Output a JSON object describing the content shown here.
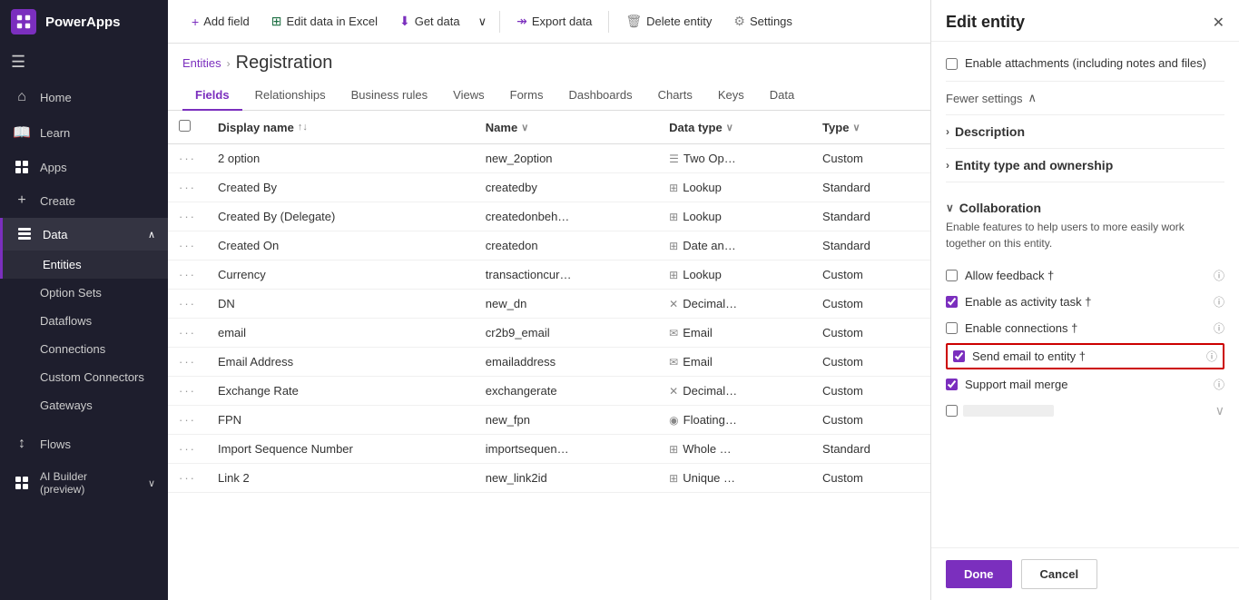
{
  "app": {
    "title": "PowerApps"
  },
  "nav": {
    "hamburger_icon": "☰",
    "logo_icon": "⊞",
    "items": [
      {
        "id": "home",
        "label": "Home",
        "icon": "⌂",
        "active": false
      },
      {
        "id": "learn",
        "label": "Learn",
        "icon": "📖",
        "active": false
      },
      {
        "id": "apps",
        "label": "Apps",
        "icon": "⊞",
        "active": false
      },
      {
        "id": "create",
        "label": "Create",
        "icon": "+",
        "active": false
      },
      {
        "id": "data",
        "label": "Data",
        "icon": "⊞",
        "active": true,
        "chevron": "∧"
      }
    ],
    "sub_items": [
      {
        "id": "entities",
        "label": "Entities",
        "active": true
      },
      {
        "id": "option-sets",
        "label": "Option Sets",
        "active": false
      },
      {
        "id": "dataflows",
        "label": "Dataflows",
        "active": false
      },
      {
        "id": "connections",
        "label": "Connections",
        "active": false
      },
      {
        "id": "custom-connectors",
        "label": "Custom Connectors",
        "active": false
      },
      {
        "id": "gateways",
        "label": "Gateways",
        "active": false
      }
    ],
    "bottom_items": [
      {
        "id": "flows",
        "label": "Flows",
        "icon": "↕"
      },
      {
        "id": "ai-builder",
        "label": "AI Builder\n(preview)",
        "icon": "⊞",
        "chevron": "∨"
      }
    ]
  },
  "toolbar": {
    "add_field_label": "Add field",
    "edit_excel_label": "Edit data in Excel",
    "get_data_label": "Get data",
    "export_data_label": "Export data",
    "delete_entity_label": "Delete entity",
    "settings_label": "Settings"
  },
  "breadcrumb": {
    "parent": "Entities",
    "separator": "›",
    "current": "Registration"
  },
  "tabs": [
    {
      "id": "fields",
      "label": "Fields",
      "active": true
    },
    {
      "id": "relationships",
      "label": "Relationships",
      "active": false
    },
    {
      "id": "business-rules",
      "label": "Business rules",
      "active": false
    },
    {
      "id": "views",
      "label": "Views",
      "active": false
    },
    {
      "id": "forms",
      "label": "Forms",
      "active": false
    },
    {
      "id": "dashboards",
      "label": "Dashboards",
      "active": false
    },
    {
      "id": "charts",
      "label": "Charts",
      "active": false
    },
    {
      "id": "keys",
      "label": "Keys",
      "active": false
    },
    {
      "id": "data",
      "label": "Data",
      "active": false
    }
  ],
  "table": {
    "columns": [
      {
        "id": "display-name",
        "label": "Display name",
        "sort": "↑↓"
      },
      {
        "id": "name",
        "label": "Name",
        "sort": "∨"
      },
      {
        "id": "data-type",
        "label": "Data type",
        "sort": "∨"
      },
      {
        "id": "type",
        "label": "Type",
        "sort": "∨"
      }
    ],
    "rows": [
      {
        "display_name": "2 option",
        "name": "new_2option",
        "data_type": "Two Op…",
        "data_type_icon": "☰",
        "type": "Custom"
      },
      {
        "display_name": "Created By",
        "name": "createdby",
        "data_type": "Lookup",
        "data_type_icon": "⊞",
        "type": "Standard"
      },
      {
        "display_name": "Created By (Delegate)",
        "name": "createdonbeh…",
        "data_type": "Lookup",
        "data_type_icon": "⊞",
        "type": "Standard"
      },
      {
        "display_name": "Created On",
        "name": "createdon",
        "data_type": "Date an…",
        "data_type_icon": "⊞",
        "type": "Standard"
      },
      {
        "display_name": "Currency",
        "name": "transactioncur…",
        "data_type": "Lookup",
        "data_type_icon": "⊞",
        "type": "Custom"
      },
      {
        "display_name": "DN",
        "name": "new_dn",
        "data_type": "Decimal…",
        "data_type_icon": "✕",
        "type": "Custom"
      },
      {
        "display_name": "email",
        "name": "cr2b9_email",
        "data_type": "Email",
        "data_type_icon": "✉",
        "type": "Custom"
      },
      {
        "display_name": "Email Address",
        "name": "emailaddress",
        "data_type": "Email",
        "data_type_icon": "✉",
        "type": "Custom"
      },
      {
        "display_name": "Exchange Rate",
        "name": "exchangerate",
        "data_type": "Decimal…",
        "data_type_icon": "✕",
        "type": "Custom"
      },
      {
        "display_name": "FPN",
        "name": "new_fpn",
        "data_type": "Floating…",
        "data_type_icon": "◉",
        "type": "Custom"
      },
      {
        "display_name": "Import Sequence Number",
        "name": "importsequen…",
        "data_type": "Whole …",
        "data_type_icon": "⊞",
        "type": "Standard"
      },
      {
        "display_name": "Link 2",
        "name": "new_link2id",
        "data_type": "Unique …",
        "data_type_icon": "⊞",
        "type": "Custom"
      }
    ]
  },
  "panel": {
    "title": "Edit entity",
    "close_icon": "✕",
    "enable_attachments_label": "Enable attachments (including notes and files)",
    "enable_attachments_checked": false,
    "fewer_settings_label": "Fewer settings",
    "sections": [
      {
        "id": "description",
        "label": "Description",
        "collapsed": true,
        "chevron": "›"
      },
      {
        "id": "entity-type",
        "label": "Entity type and ownership",
        "collapsed": true,
        "chevron": "›"
      }
    ],
    "collaboration": {
      "title": "Collaboration",
      "expanded": true,
      "chevron": "∨",
      "description": "Enable features to help users to more easily work together on this entity.",
      "items": [
        {
          "id": "allow-feedback",
          "label": "Allow feedback †",
          "checked": false,
          "highlighted": false
        },
        {
          "id": "enable-activity-task",
          "label": "Enable as activity task †",
          "checked": true,
          "highlighted": false
        },
        {
          "id": "enable-connections",
          "label": "Enable connections †",
          "checked": false,
          "highlighted": false
        },
        {
          "id": "send-email",
          "label": "Send email to entity †",
          "checked": true,
          "highlighted": true
        },
        {
          "id": "support-mail-merge",
          "label": "Support mail merge",
          "checked": true,
          "highlighted": false
        }
      ]
    },
    "footer": {
      "done_label": "Done",
      "cancel_label": "Cancel"
    }
  }
}
